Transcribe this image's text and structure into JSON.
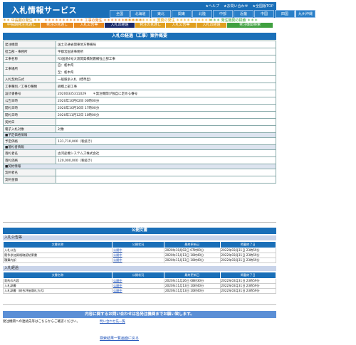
{
  "app": {
    "title": "入札情報サービス",
    "util_links": [
      "★ヘルプ",
      "★お問い合わせ",
      "★全国版TOP"
    ]
  },
  "regions": [
    "全国",
    "北海道",
    "東北",
    "関東",
    "北陸",
    "中部",
    "近畿",
    "中国",
    "四国",
    "九州沖縄"
  ],
  "categories": {
    "center_label": "＊＊ 中長期の発注 ＊＊",
    "works_label": "＊＊＊＊＊＊＊＊＊＊＊ 工事の発注 ＊＊＊＊＊＊＊＊＊＊＊",
    "services_label": "＊＊＊＊＊＊＊＊＊ 業務の発注 ＊＊＊＊＊＊＊＊＊＊",
    "agency_label": "＊＊＊ 発注機関の検索 ＊＊＊"
  },
  "tabs": [
    {
      "label": "中長期発注見通し",
      "color": "#e0a020"
    },
    {
      "label": "発注の見通し",
      "color": "#e88a20"
    },
    {
      "label": "入札公告等",
      "color": "#e88a20"
    },
    {
      "label": "入札の経過",
      "color": "#1a2a6a"
    },
    {
      "label": "発注の見通し",
      "color": "#e0a020"
    },
    {
      "label": "入札公告等",
      "color": "#e0a020"
    },
    {
      "label": "入札の経過",
      "color": "#e0a020"
    },
    {
      "label": "発注機関検索",
      "color": "#40a040"
    }
  ],
  "page_title": "入札の経過（工事）案件概要",
  "detail": {
    "rows": [
      {
        "label": "発注機関",
        "value": "国土交通省関東地方整備局"
      },
      {
        "label": "担当部・事務所",
        "value": "宇都宮国道事務所"
      },
      {
        "label": "工事名称",
        "value": "R3国道4号大渡開発橋耐震補強上部工事"
      },
      {
        "label": "工事場所",
        "value": "自：栃木県",
        "value2": "至：栃木県"
      },
      {
        "label": "入札契約方式",
        "value": "一般競争入札（標準型）"
      },
      {
        "label": "工事種別／工事の種類",
        "value": "鋼橋上部工事"
      },
      {
        "label": "設計書番号",
        "value": "20200335311029　　＊発注機関が独自に定める番号"
      },
      {
        "label": "公告日時",
        "value": "2020年10月02日 00時00分"
      },
      {
        "label": "開札日時",
        "value": "2020年10月16日 17時00分"
      },
      {
        "label": "開札日時",
        "value": "2020年11月12日 10時00分"
      },
      {
        "label": "契約日",
        "value": ""
      },
      {
        "label": "電子入札対象",
        "value": "対象"
      }
    ],
    "section_budget": "■予定価格情報",
    "budget": {
      "label": "予定価格",
      "value": "131,710,000（税抜き）"
    },
    "section_winner": "■落札者情報",
    "winner": [
      {
        "label": "落札者名",
        "value": "古河産機システムズ株式会社"
      },
      {
        "label": "落札価格",
        "value": "120,000,000（税抜き）"
      }
    ],
    "section_contract": "■契約情報",
    "contract": [
      {
        "label": "契約者名",
        "value": ""
      },
      {
        "label": "契約金額",
        "value": ""
      }
    ]
  },
  "public_docs": {
    "title": "公開文書",
    "notice_section": "入札公告等",
    "headers": [
      "文書名称",
      "公開状況",
      "最終更新日",
      "掲載終了日"
    ],
    "notice_rows": [
      [
        "入札公告",
        "公開中",
        "2020年10月02日 07時00分",
        "2022年03月31日 23時59分"
      ],
      [
        "競争参加資格確認結果書",
        "公開中",
        "2020年11月13日 10時40分",
        "2022年03月31日 23時59分"
      ],
      [
        "積算内訳",
        "公開中",
        "2020年11月13日 10時40分",
        "2022年03月31日 23時59分"
      ]
    ],
    "progress_section": "入札経過",
    "progress_rows": [
      [
        "契約の内容",
        "公開中",
        "2020年11月26日 08時30分",
        "2022年03月31日 23時59分"
      ],
      [
        "入札調書",
        "公開中",
        "2020年11月13日 10時40分",
        "2022年03月31日 23時59分"
      ],
      [
        "入札調書（総合評価落札方式）",
        "公開中",
        "2020年11月13日 10時40分",
        "2022年03月31日 23時59分"
      ]
    ]
  },
  "inquiry": {
    "title": "内容に関するお問い合わせは各発注機関までお願い致します。",
    "text": "発注機関への連絡先等はこちらからご確認ください。",
    "link": "問い合わせ先一覧"
  },
  "back_link": "検索結果一覧画面に戻る"
}
